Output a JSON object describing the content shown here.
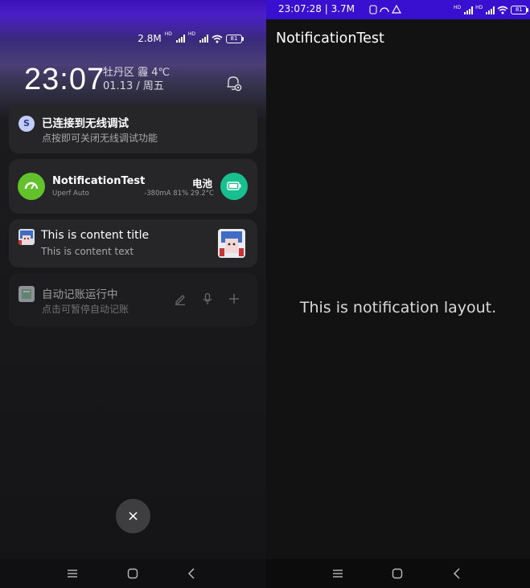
{
  "left_panel": {
    "status": {
      "speed": "2.8M",
      "battery": "81",
      "hd1": "HD",
      "hd2": "HD"
    },
    "clock": "23:07",
    "location_weather": "牡丹区 霾 4℃",
    "date": "01.13 / 周五",
    "notifications": [
      {
        "title": "已连接到无线调试",
        "text": "点按即可关闭无线调试功能",
        "icon_label": "S"
      },
      {
        "app": "NotificationTest",
        "sub": "Uperf Auto",
        "right_title": "电池",
        "right_text": "-380mA 81% 29.2°C"
      },
      {
        "title": "This is content title",
        "text": "This is content text"
      },
      {
        "title": "自动记账运行中",
        "text": "点击可暂停自动记账"
      }
    ],
    "close_symbol": "×"
  },
  "right_panel": {
    "status": {
      "text": "23:07:28 | 3.7M",
      "battery": "81",
      "hd1": "HD",
      "hd2": "HD"
    },
    "app_title": "NotificationTest",
    "body_text": "This is notification layout."
  },
  "colors": {
    "accent_status_bar": "#3a10d0",
    "gauge_green": "#63c22b",
    "battery_teal": "#17c08e"
  }
}
